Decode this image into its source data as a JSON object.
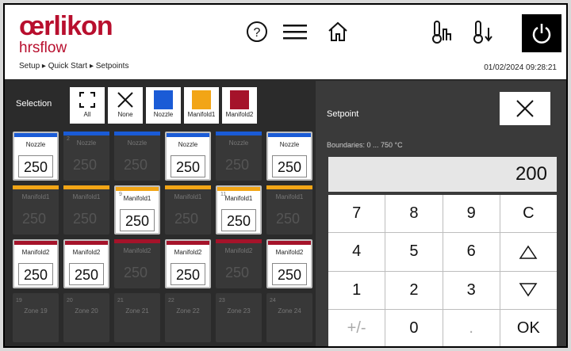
{
  "header": {
    "brand": "œrlikon",
    "subbrand": "hrsflow",
    "breadcrumb": "Setup ▸ Quick Start ▸ Setpoints",
    "datetime": "01/02/2024 09:28:21",
    "icons": [
      "help-icon",
      "menu-icon",
      "home-icon",
      "temp-bars-icon",
      "temp-down-icon",
      "power-icon"
    ]
  },
  "selection": {
    "label": "Selection",
    "buttons": [
      {
        "name": "select-all-icon",
        "caption": "All"
      },
      {
        "name": "select-none-icon",
        "caption": "None"
      },
      {
        "name": "nozzle",
        "caption": "Nozzle",
        "color": "#1a5bd6"
      },
      {
        "name": "manifold1",
        "caption": "Manifold1",
        "color": "#f2a516"
      },
      {
        "name": "manifold2",
        "caption": "Manifold2",
        "color": "#a5132a"
      }
    ]
  },
  "colors": {
    "brand": "#b80f2e",
    "nozzle": "#1a5bd6",
    "manifold1": "#f2a516",
    "manifold2": "#a5132a"
  },
  "zones": [
    {
      "num": "",
      "name": "Nozzle",
      "value": "250",
      "type": "nozzle",
      "active": true
    },
    {
      "num": "2",
      "name": "Nozzle",
      "value": "250",
      "type": "nozzle",
      "active": false
    },
    {
      "num": "",
      "name": "Nozzle",
      "value": "250",
      "type": "nozzle",
      "active": false
    },
    {
      "num": "",
      "name": "Nozzle",
      "value": "250",
      "type": "nozzle",
      "active": true
    },
    {
      "num": "",
      "name": "Nozzle",
      "value": "250",
      "type": "nozzle",
      "active": false
    },
    {
      "num": "",
      "name": "Nozzle",
      "value": "250",
      "type": "nozzle",
      "active": true
    },
    {
      "num": "",
      "name": "Manifold1",
      "value": "250",
      "type": "manifold1",
      "active": false
    },
    {
      "num": "",
      "name": "Manifold1",
      "value": "250",
      "type": "manifold1",
      "active": false
    },
    {
      "num": "9",
      "name": "Manifold1",
      "value": "250",
      "type": "manifold1",
      "active": true
    },
    {
      "num": "",
      "name": "Manifold1",
      "value": "250",
      "type": "manifold1",
      "active": false
    },
    {
      "num": "11",
      "name": "Manifold1",
      "value": "250",
      "type": "manifold1",
      "active": true
    },
    {
      "num": "",
      "name": "Manifold1",
      "value": "250",
      "type": "manifold1",
      "active": false
    },
    {
      "num": "",
      "name": "Manifold2",
      "value": "250",
      "type": "manifold2",
      "active": true
    },
    {
      "num": "",
      "name": "Manifold2",
      "value": "250",
      "type": "manifold2",
      "active": true
    },
    {
      "num": "",
      "name": "Manifold2",
      "value": "250",
      "type": "manifold2",
      "active": false
    },
    {
      "num": "",
      "name": "Manifold2",
      "value": "250",
      "type": "manifold2",
      "active": true
    },
    {
      "num": "",
      "name": "Manifold2",
      "value": "250",
      "type": "manifold2",
      "active": false
    },
    {
      "num": "",
      "name": "Manifold2",
      "value": "250",
      "type": "manifold2",
      "active": true
    },
    {
      "num": "19",
      "name": "Zone 19",
      "value": "",
      "type": "empty",
      "active": false
    },
    {
      "num": "20",
      "name": "Zone 20",
      "value": "",
      "type": "empty",
      "active": false
    },
    {
      "num": "21",
      "name": "Zone 21",
      "value": "",
      "type": "empty",
      "active": false
    },
    {
      "num": "22",
      "name": "Zone 22",
      "value": "",
      "type": "empty",
      "active": false
    },
    {
      "num": "23",
      "name": "Zone 23",
      "value": "",
      "type": "empty",
      "active": false
    },
    {
      "num": "24",
      "name": "Zone 24",
      "value": "",
      "type": "empty",
      "active": false
    }
  ],
  "setpoint": {
    "title": "Setpoint",
    "boundaries": "Boundaries: 0 ... 750 °C",
    "value": "200",
    "keys": [
      "7",
      "8",
      "9",
      "C",
      "4",
      "5",
      "6",
      "▲",
      "1",
      "2",
      "3",
      "▼",
      "+/-",
      "0",
      ".",
      "OK"
    ]
  }
}
